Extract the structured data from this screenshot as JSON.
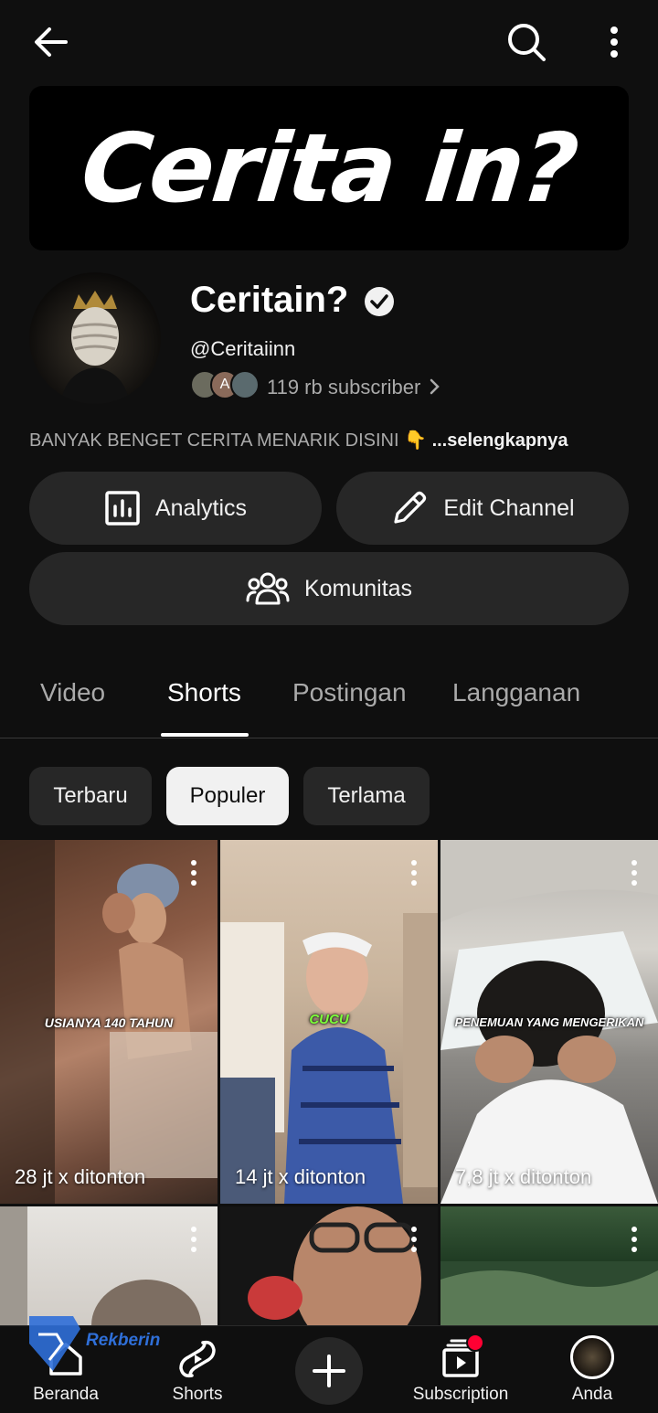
{
  "topbar": {
    "back_icon": "arrow-left-icon",
    "search_icon": "search-icon",
    "more_icon": "more-vertical-icon"
  },
  "banner": {
    "text": "Cerita in?"
  },
  "channel": {
    "name": "Ceritain?",
    "handle": "@Ceritaiinn",
    "subscribers": "119 rb subscriber",
    "sub_avatar_letter": "A",
    "description": "BANYAK BENGET CERITA MENARIK DISINI 👇",
    "more_link": "...selengkapnya"
  },
  "actions": {
    "analytics": "Analytics",
    "edit_channel": "Edit Channel",
    "komunitas": "Komunitas"
  },
  "tabs": [
    {
      "label": "Video",
      "active": false
    },
    {
      "label": "Shorts",
      "active": true
    },
    {
      "label": "Postingan",
      "active": false
    },
    {
      "label": "Langganan",
      "active": false
    }
  ],
  "filters": [
    {
      "label": "Terbaru",
      "selected": false
    },
    {
      "label": "Populer",
      "selected": true
    },
    {
      "label": "Terlama",
      "selected": false
    }
  ],
  "shorts": [
    {
      "views": "28 jt x ditonton",
      "caption": "USIANYA 140 TAHUN"
    },
    {
      "views": "14 jt x ditonton",
      "caption": "CUCU"
    },
    {
      "views": "7,8 jt x ditonton",
      "caption": "PENEMUAN YANG MENGERIKAN"
    }
  ],
  "bottom_nav": {
    "home": "Beranda",
    "shorts": "Shorts",
    "create_icon": "plus-icon",
    "subscription": "Subscription",
    "you": "Anda"
  },
  "watermark": {
    "text": "Rekberin"
  },
  "colors": {
    "background": "#0f0f0f",
    "surface": "#272727",
    "text_secondary": "#aaaaaa",
    "notification": "#ff0033",
    "cucu_caption": "#7dff3a"
  }
}
